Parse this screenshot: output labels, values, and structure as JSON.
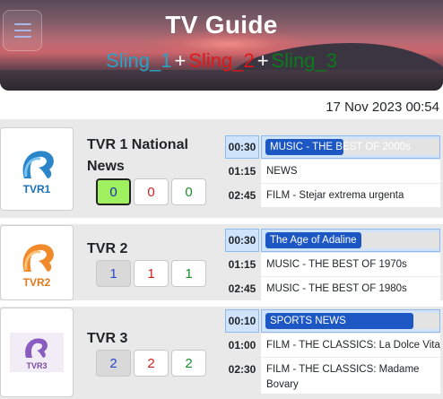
{
  "header": {
    "title": "TV Guide",
    "menu_icon": "hamburger-icon",
    "slings": [
      {
        "label": "Sling_1",
        "color": "#29a3c7"
      },
      {
        "label": "Sling_2",
        "color": "#e01818"
      },
      {
        "label": "Sling_3",
        "color": "#0b7a1a"
      }
    ],
    "plus": "+"
  },
  "clock": "17 Nov 2023 00:54",
  "channels": [
    {
      "name": "TVR 1 National News",
      "logo_text": "TVR1",
      "logo_color": "#1b6fb3",
      "counts": [
        "0",
        "0",
        "0"
      ],
      "schedule": [
        {
          "time": "00:30",
          "title": "MUSIC - THE BEST OF 2000s",
          "progress": 0.45
        },
        {
          "time": "01:15",
          "title": "NEWS"
        },
        {
          "time": "02:45",
          "title": "FILM - Stejar extrema urgenta"
        }
      ]
    },
    {
      "name": "TVR 2",
      "logo_text": "TVR2",
      "logo_color": "#e07a1b",
      "counts": [
        "1",
        "1",
        "1"
      ],
      "schedule": [
        {
          "time": "00:30",
          "title": "The Age of Adaline",
          "progress": 0.55
        },
        {
          "time": "01:15",
          "title": "MUSIC - THE BEST OF 1970s"
        },
        {
          "time": "02:45",
          "title": "MUSIC - THE BEST OF 1980s"
        }
      ]
    },
    {
      "name": "TVR 3",
      "logo_text": "TVR3",
      "logo_color": "#7b4aa8",
      "counts": [
        "2",
        "2",
        "2"
      ],
      "schedule": [
        {
          "time": "00:10",
          "title": "SPORTS NEWS",
          "progress": 0.85
        },
        {
          "time": "01:00",
          "title": "FILM - THE CLASSICS: La Dolce Vita"
        },
        {
          "time": "02:30",
          "title": "FILM - THE CLASSICS: Madame Bovary"
        }
      ]
    }
  ]
}
